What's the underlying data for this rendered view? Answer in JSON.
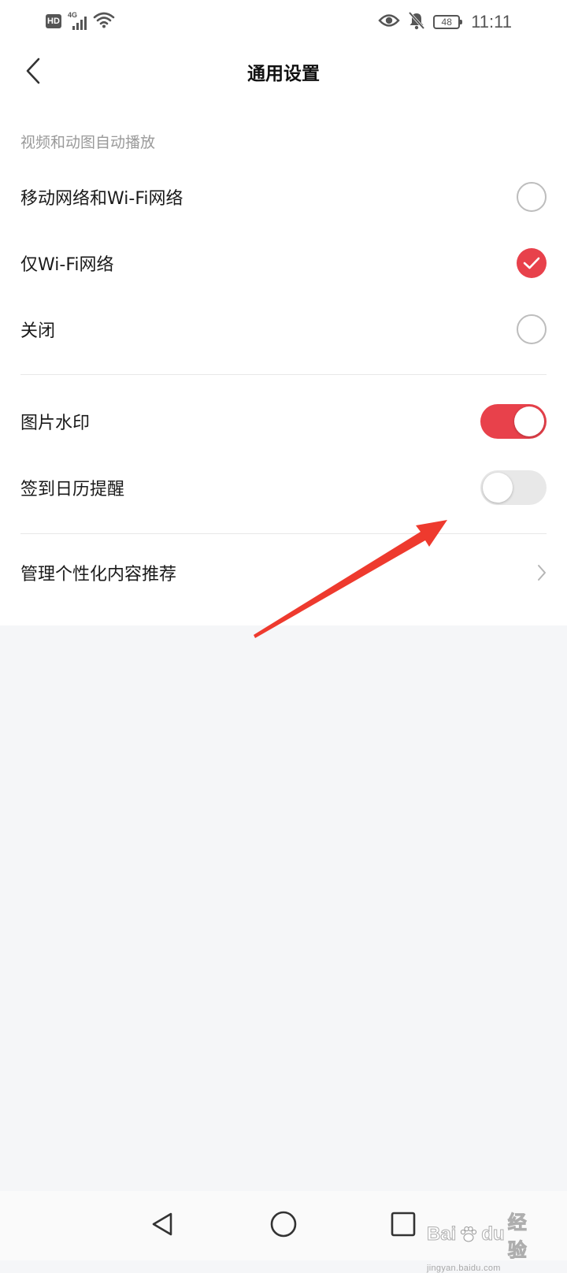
{
  "status_bar": {
    "hd_badge": "HD",
    "network_type": "4G",
    "battery_level": "48",
    "time": "11:11",
    "icons": [
      "hd-icon",
      "signal-icon",
      "wifi-icon",
      "eye-icon",
      "bell-muted-icon",
      "battery-icon"
    ]
  },
  "header": {
    "title": "通用设置",
    "back_icon": "chevron-left-icon"
  },
  "autoplay_section": {
    "label": "视频和动图自动播放",
    "options": [
      {
        "label": "移动网络和Wi-Fi网络",
        "selected": false
      },
      {
        "label": "仅Wi-Fi网络",
        "selected": true
      },
      {
        "label": "关闭",
        "selected": false
      }
    ]
  },
  "toggles": [
    {
      "label": "图片水印",
      "on": true
    },
    {
      "label": "签到日历提醒",
      "on": false
    }
  ],
  "personalization": {
    "label": "管理个性化内容推荐",
    "icon": "chevron-right-icon"
  },
  "navigation_bar": {
    "icons": [
      "nav-back-triangle-icon",
      "nav-home-circle-icon",
      "nav-recents-square-icon"
    ]
  },
  "watermark": {
    "brand_prefix": "Bai",
    "brand_suffix": "du",
    "brand_cn": "经验",
    "url": "jingyan.baidu.com"
  },
  "colors": {
    "accent": "#e8414b",
    "annotation_arrow": "#ee3a2e",
    "page_background": "#f5f6f8",
    "card_background": "#ffffff"
  }
}
